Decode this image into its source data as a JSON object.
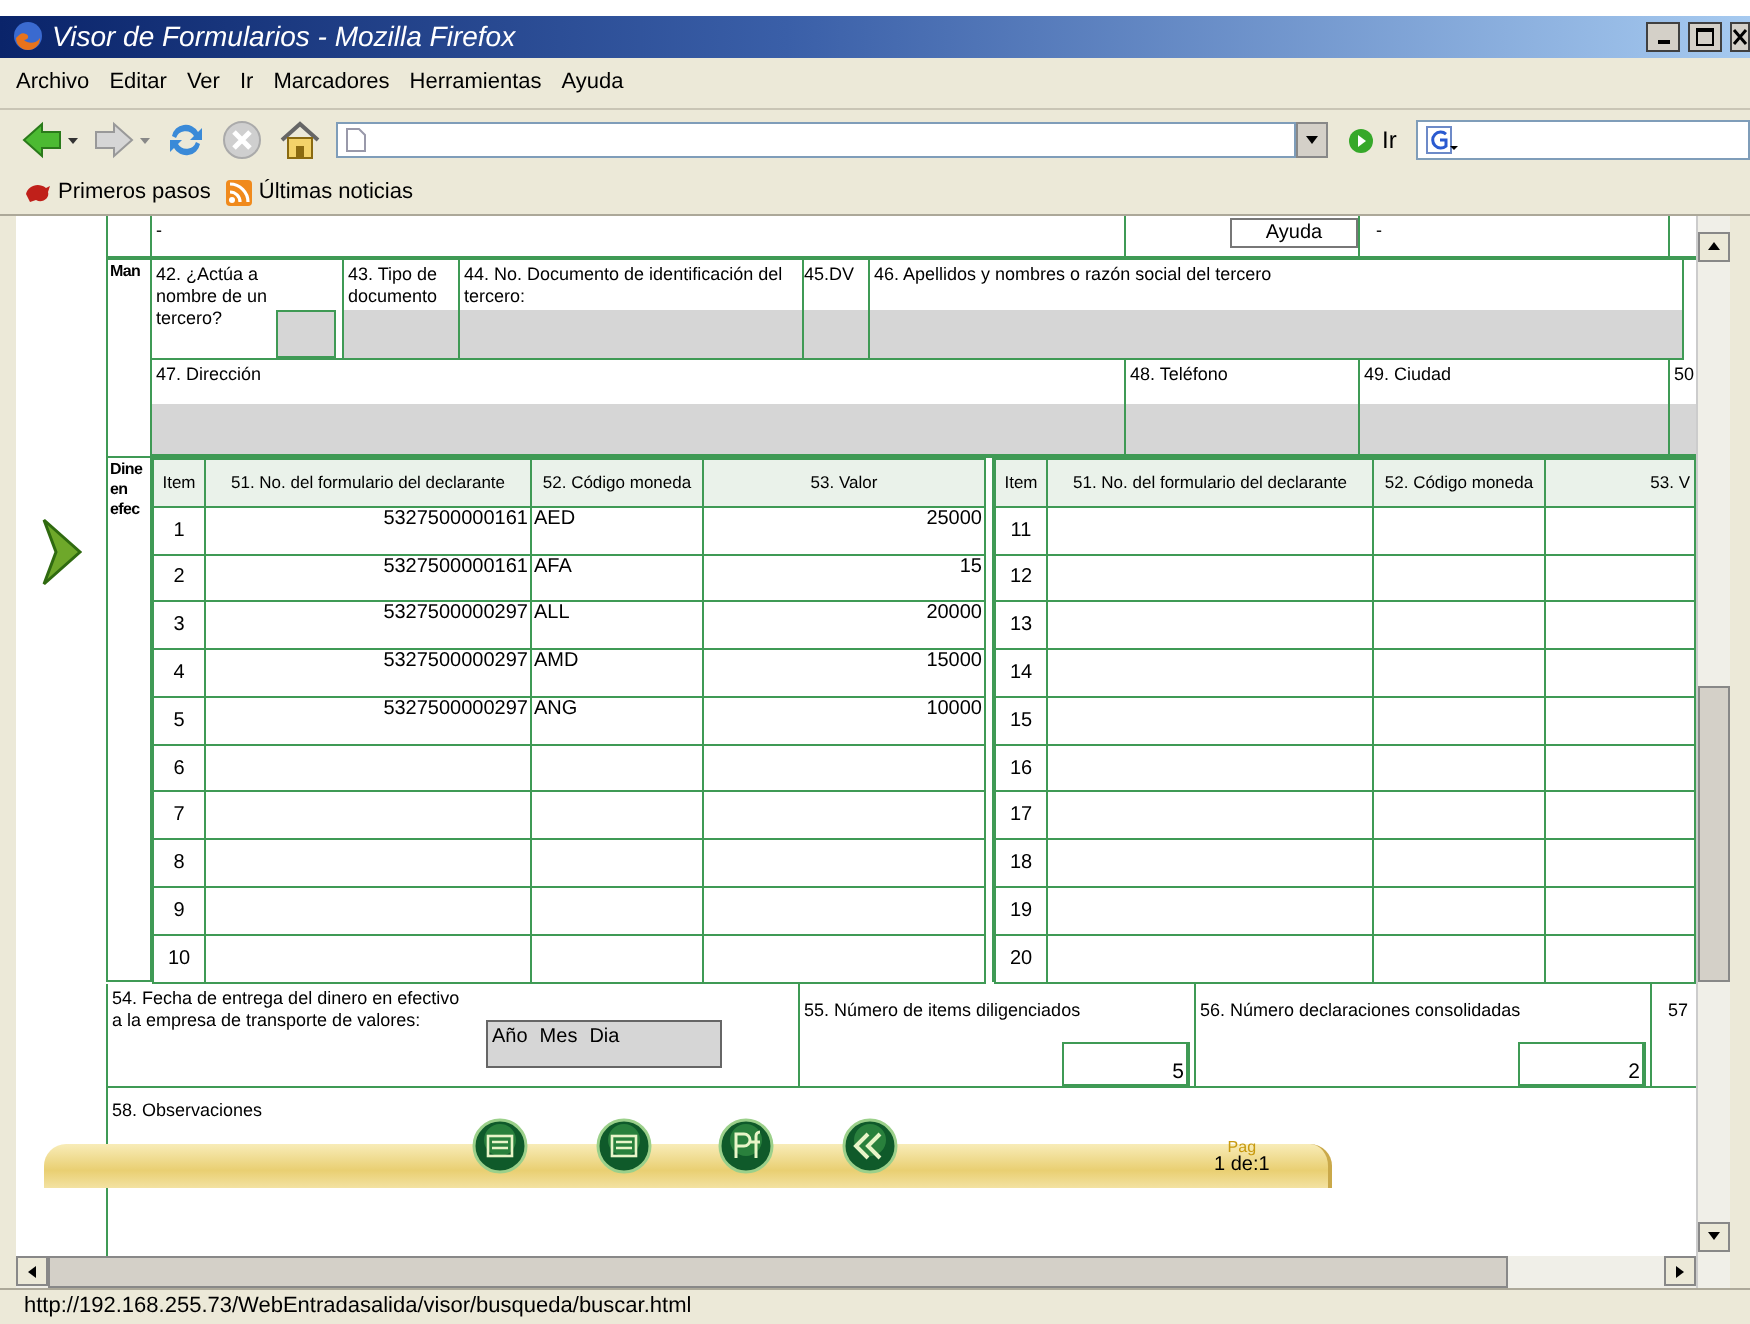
{
  "window": {
    "title": "Visor de Formularios - Mozilla Firefox"
  },
  "menu": [
    "Archivo",
    "Editar",
    "Ver",
    "Ir",
    "Marcadores",
    "Herramientas",
    "Ayuda"
  ],
  "toolbar": {
    "go_label": "Ir"
  },
  "bookmarks": [
    "Primeros pasos",
    "Últimas noticias"
  ],
  "form": {
    "top_row": {
      "left_text": "-",
      "button": "Ayuda",
      "right_text": "-"
    },
    "third_party": {
      "label": "Man",
      "fields": [
        {
          "label": "42. ¿Actúa a nombre de un tercero?"
        },
        {
          "label": "43. Tipo de documento"
        },
        {
          "label": "44. No. Documento de identificación del tercero:"
        },
        {
          "label": "45.DV"
        },
        {
          "label": "46. Apellidos y nombres o razón social del tercero"
        }
      ],
      "address_fields": [
        {
          "label": "47. Dirección"
        },
        {
          "label": "48. Teléfono"
        },
        {
          "label": "49. Ciudad"
        },
        {
          "label": "50"
        }
      ]
    },
    "cash": {
      "label": "Dine en efec",
      "left_columns": [
        "Item",
        "51. No. del formulario del declarante",
        "52. Código moneda",
        "53. Valor"
      ],
      "right_columns": [
        "Item",
        "51. No. del formulario del declarante",
        "52. Código moneda",
        "53. V"
      ],
      "left_rows": [
        {
          "item": "1",
          "form_number": "5327500000161",
          "currency": "AED",
          "value": "25000"
        },
        {
          "item": "2",
          "form_number": "5327500000161",
          "currency": "AFA",
          "value": "15"
        },
        {
          "item": "3",
          "form_number": "5327500000297",
          "currency": "ALL",
          "value": "20000"
        },
        {
          "item": "4",
          "form_number": "5327500000297",
          "currency": "AMD",
          "value": "15000"
        },
        {
          "item": "5",
          "form_number": "5327500000297",
          "currency": "ANG",
          "value": "10000"
        },
        {
          "item": "6"
        },
        {
          "item": "7"
        },
        {
          "item": "8"
        },
        {
          "item": "9"
        },
        {
          "item": "10"
        }
      ],
      "right_rows": [
        {
          "item": "11"
        },
        {
          "item": "12"
        },
        {
          "item": "13"
        },
        {
          "item": "14"
        },
        {
          "item": "15"
        },
        {
          "item": "16"
        },
        {
          "item": "17"
        },
        {
          "item": "18"
        },
        {
          "item": "19"
        },
        {
          "item": "20"
        }
      ]
    },
    "delivery_date": {
      "lines": [
        "54. Fecha de entrega del dinero en efectivo",
        "a la empresa de transporte de valores:"
      ],
      "parts": [
        "Año",
        "Mes",
        "Dia"
      ]
    },
    "items_count": {
      "label": "55. Número de items diligenciados",
      "value": "5"
    },
    "declarations_count": {
      "label": "56. Número declaraciones consolidadas",
      "value": "2"
    },
    "field_57": {
      "label": "57"
    },
    "observations": {
      "label": "58. Observaciones"
    }
  },
  "viewer_bar": {
    "page_label": "Pag",
    "page": "1 de:1"
  },
  "status_bar": {
    "text": "http://192.168.255.73/WebEntradasalida/visor/busqueda/buscar.html"
  }
}
